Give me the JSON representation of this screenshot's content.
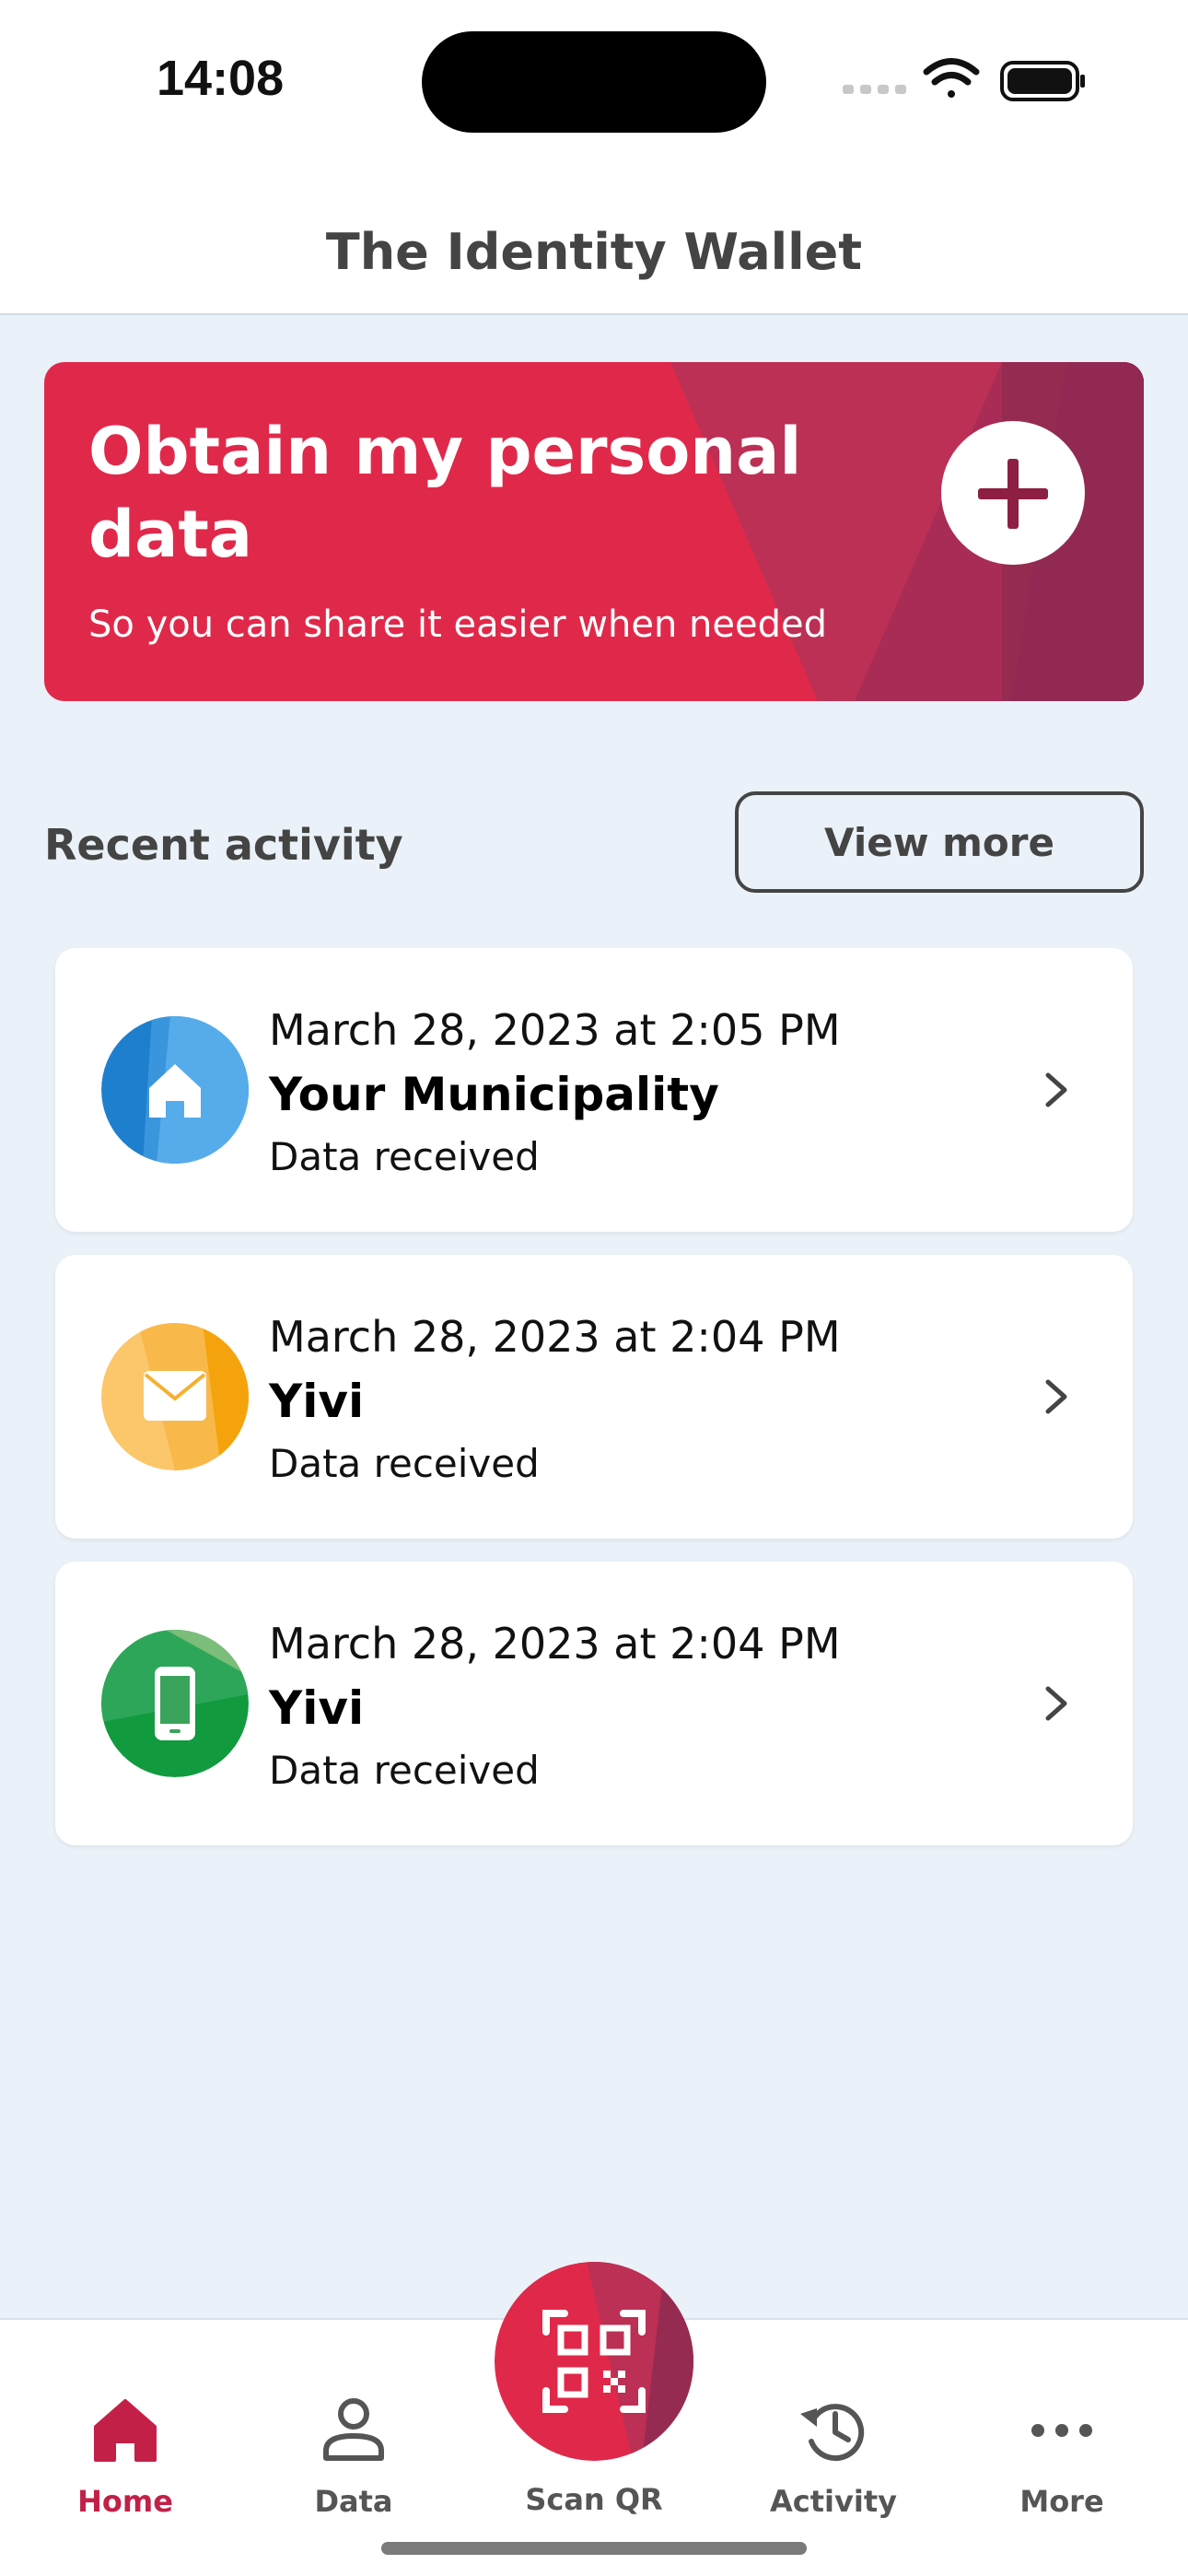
{
  "status_bar": {
    "time": "14:08"
  },
  "header": {
    "title": "The Identity Wallet"
  },
  "banner": {
    "title": "Obtain my personal data",
    "subtitle": "So you can share it easier when needed",
    "icon": "plus-icon"
  },
  "recent": {
    "title": "Recent activity",
    "view_more_label": "View more",
    "items": [
      {
        "date": "March 28, 2023 at 2:05 PM",
        "name": "Your Municipality",
        "status": "Data received",
        "icon": "house-icon",
        "color": "#2f8fd8"
      },
      {
        "date": "March 28, 2023 at 2:04 PM",
        "name": "Yivi",
        "status": "Data received",
        "icon": "envelope-icon",
        "color": "#f7ab1e"
      },
      {
        "date": "March 28, 2023 at 2:04 PM",
        "name": "Yivi",
        "status": "Data received",
        "icon": "phone-icon",
        "color": "#1a9a45"
      }
    ]
  },
  "tabbar": {
    "tabs": [
      {
        "label": "Home",
        "icon": "home-icon",
        "active": true
      },
      {
        "label": "Data",
        "icon": "user-icon",
        "active": false
      },
      {
        "label": "Scan QR",
        "icon": "qr-code-icon",
        "active": false
      },
      {
        "label": "Activity",
        "icon": "history-icon",
        "active": false
      },
      {
        "label": "More",
        "icon": "more-icon",
        "active": false
      }
    ]
  },
  "colors": {
    "accent": "#e0294a",
    "accent_dark": "#8d1f42",
    "background": "#eaf1f8",
    "active_tab": "#c32048"
  }
}
